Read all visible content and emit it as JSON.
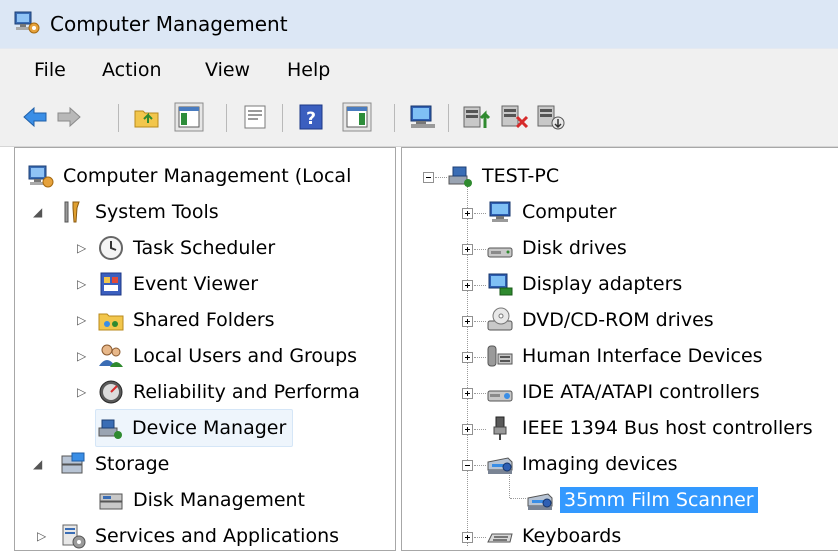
{
  "window": {
    "title": "Computer Management"
  },
  "menu": [
    {
      "label": "File"
    },
    {
      "label": "Action"
    },
    {
      "label": "View"
    },
    {
      "label": "Help"
    }
  ],
  "toolbar": {
    "buttons": [
      {
        "icon": "back-arrow-icon"
      },
      {
        "icon": "forward-arrow-icon"
      },
      {
        "icon": "up-folder-icon"
      },
      {
        "icon": "show-hide-console-tree-icon"
      },
      {
        "icon": "properties-icon"
      },
      {
        "icon": "help-icon"
      },
      {
        "icon": "show-hide-action-pane-icon"
      },
      {
        "icon": "scan-hardware-icon"
      },
      {
        "icon": "update-driver-icon"
      },
      {
        "icon": "uninstall-device-icon"
      },
      {
        "icon": "disable-device-icon"
      }
    ]
  },
  "console_tree": {
    "root": "Computer Management (Local",
    "items": [
      {
        "label": "System Tools",
        "expander": "expanded"
      },
      {
        "label": "Task Scheduler",
        "expander": "collapsed"
      },
      {
        "label": "Event Viewer",
        "expander": "collapsed"
      },
      {
        "label": "Shared Folders",
        "expander": "collapsed"
      },
      {
        "label": "Local Users and Groups",
        "expander": "collapsed"
      },
      {
        "label": "Reliability and Performa",
        "expander": "collapsed"
      },
      {
        "label": "Device Manager",
        "expander": "none",
        "state": "hover"
      },
      {
        "label": "Storage",
        "expander": "expanded"
      },
      {
        "label": "Disk Management",
        "expander": "none"
      },
      {
        "label": "Services and Applications",
        "expander": "collapsed"
      }
    ]
  },
  "device_tree": {
    "root": "TEST-PC",
    "items": [
      {
        "label": "Computer",
        "toggle": "+"
      },
      {
        "label": "Disk drives",
        "toggle": "+"
      },
      {
        "label": "Display adapters",
        "toggle": "+"
      },
      {
        "label": "DVD/CD-ROM drives",
        "toggle": "+"
      },
      {
        "label": "Human Interface Devices",
        "toggle": "+"
      },
      {
        "label": "IDE ATA/ATAPI controllers",
        "toggle": "+"
      },
      {
        "label": "IEEE 1394 Bus host controllers",
        "toggle": "+"
      },
      {
        "label": "Imaging devices",
        "toggle": "-"
      },
      {
        "label": "35mm Film Scanner",
        "toggle": "none",
        "state": "selected"
      },
      {
        "label": "Keyboards",
        "toggle": "+"
      }
    ]
  },
  "colors": {
    "title_bar": "#dce7f5",
    "selection": "#3399ff",
    "menu_bg": "#f0f0f0"
  }
}
